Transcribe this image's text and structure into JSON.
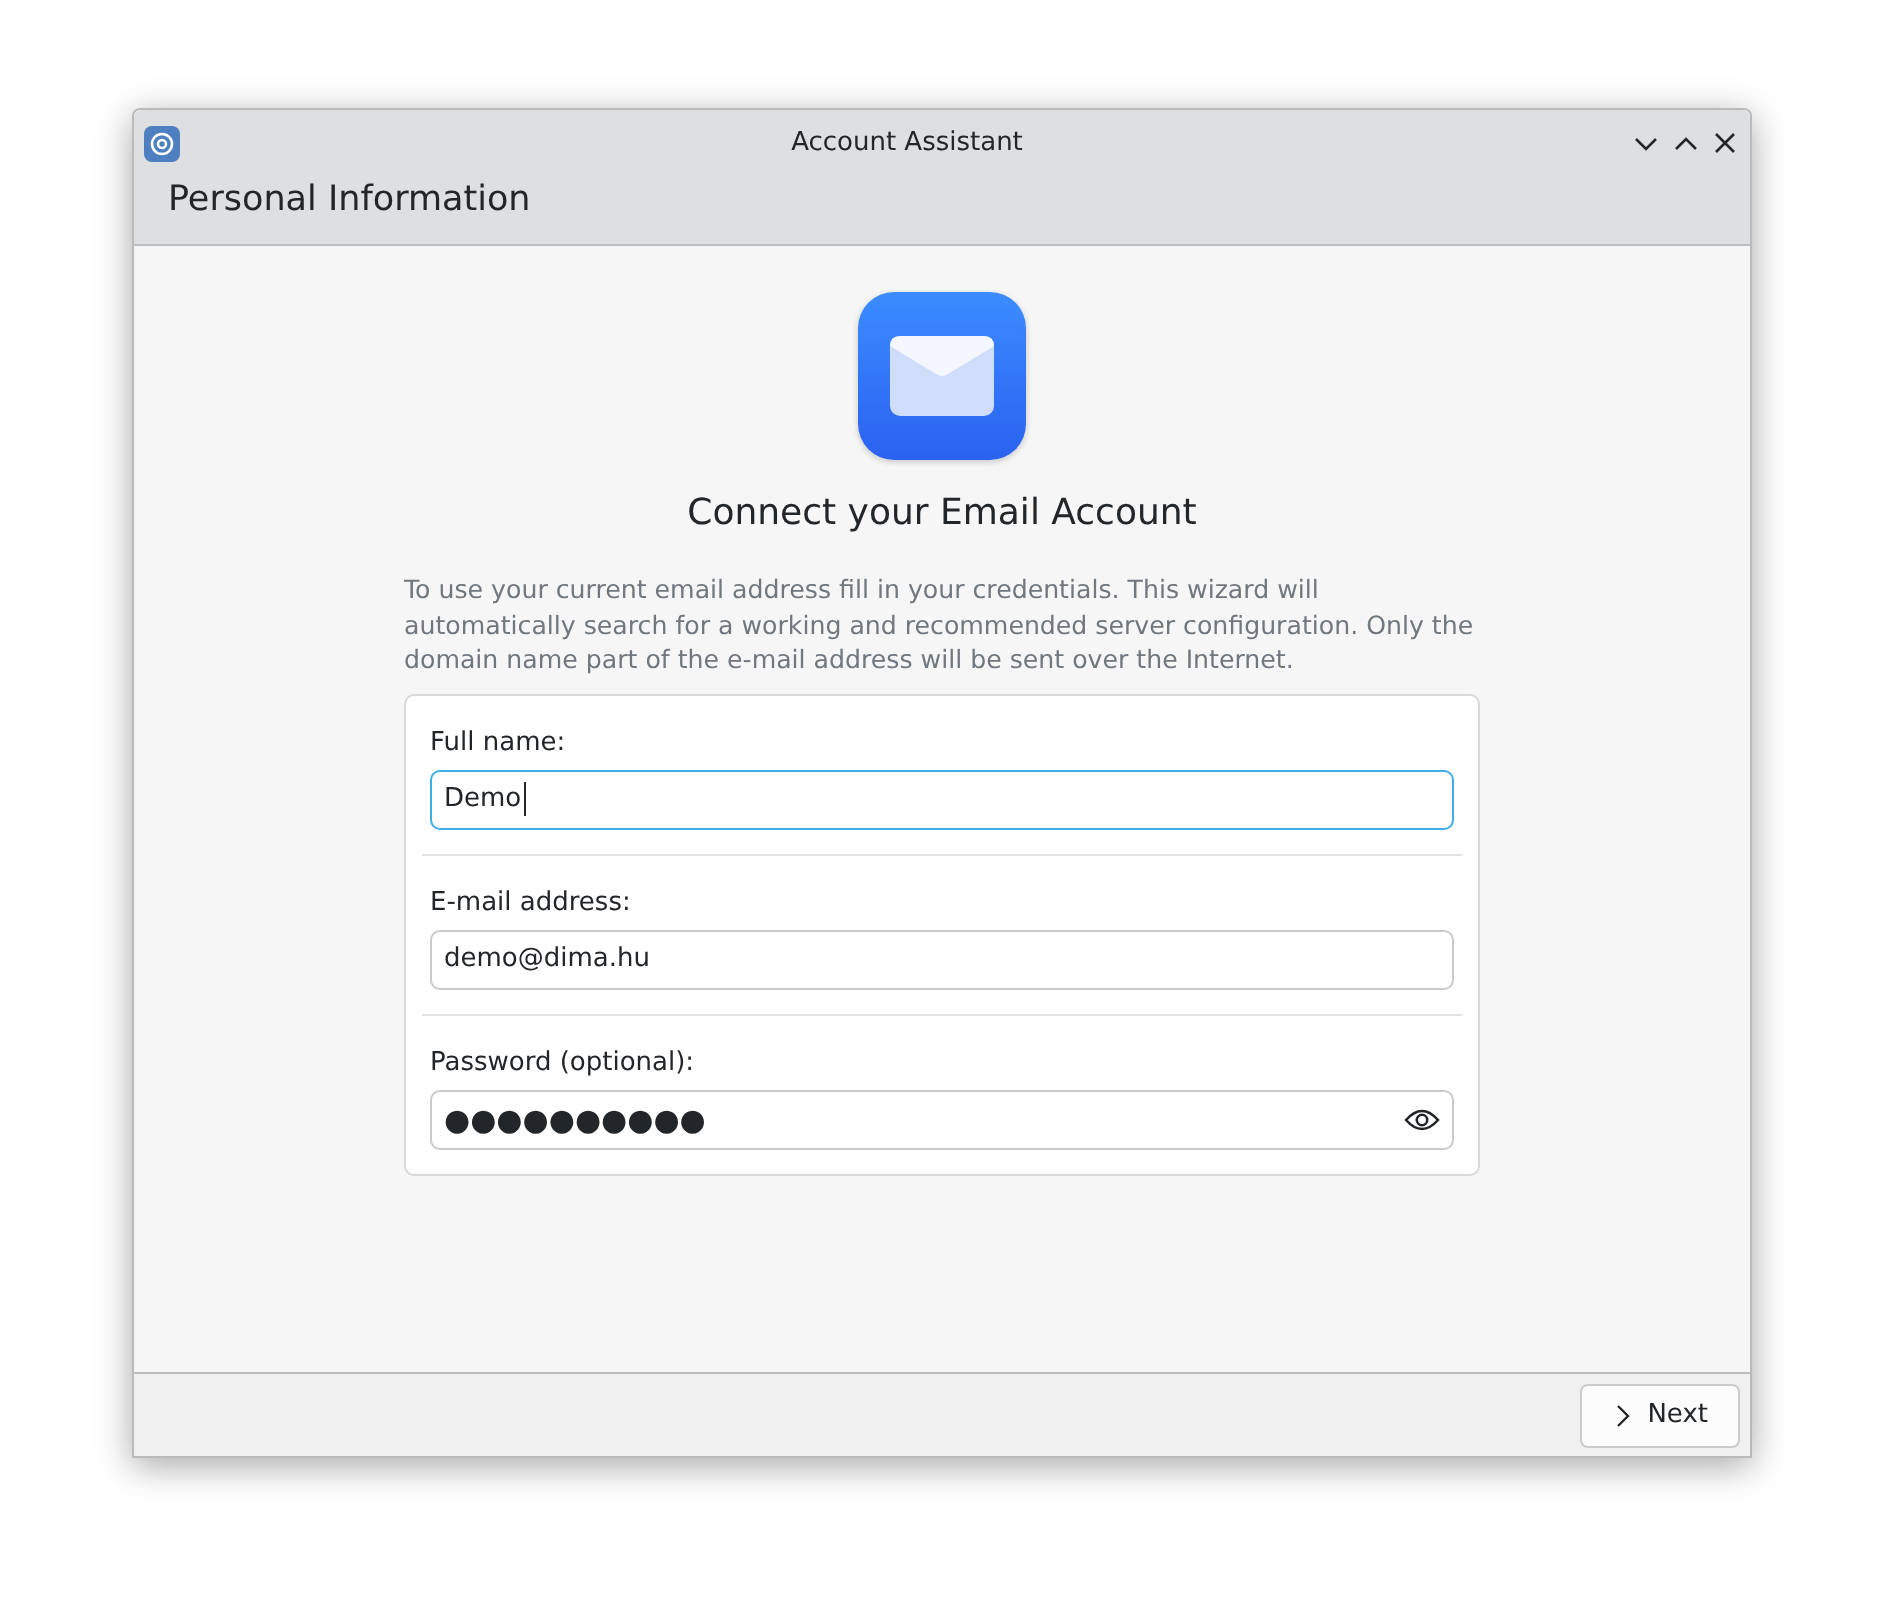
{
  "window": {
    "title": "Account Assistant"
  },
  "page_title": "Personal Information",
  "heading": "Connect your Email Account",
  "description": "To use your current email address fill in your credentials. This wizard will automatically search for a working and recommended server configuration. Only the domain name part of the e-mail address will be sent over the Internet.",
  "fields": [
    {
      "label": "Full name:",
      "value": "Demo",
      "kind": "text",
      "focused": true
    },
    {
      "label": "E-mail address:",
      "value": "demo@dima.hu",
      "kind": "text",
      "focused": false
    },
    {
      "label": "Password (optional):",
      "value": "●●●●●●●●●●",
      "kind": "password",
      "focused": false
    }
  ],
  "buttons": [
    {
      "label": "Next"
    }
  ]
}
